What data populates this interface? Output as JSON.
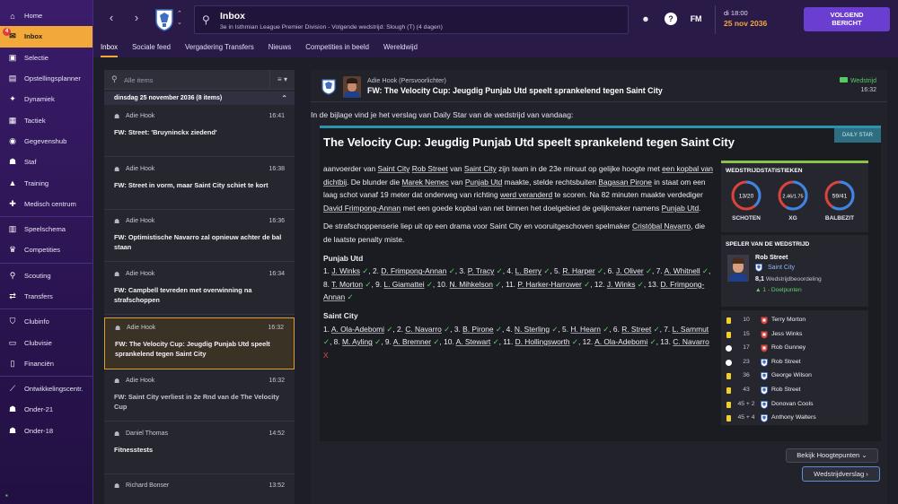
{
  "sidebar": {
    "items": [
      {
        "label": "Home",
        "icon": "home-icon"
      },
      {
        "label": "Inbox",
        "icon": "inbox-icon",
        "badge": "4",
        "active": true
      },
      {
        "label": "Selectie",
        "icon": "shirt-icon"
      },
      {
        "label": "Opstellingsplanner",
        "icon": "planner-icon"
      },
      {
        "label": "Dynamiek",
        "icon": "dynamics-icon"
      },
      {
        "label": "Tactiek",
        "icon": "tactics-icon"
      },
      {
        "label": "Gegevenshub",
        "icon": "data-hub-icon"
      },
      {
        "label": "Staf",
        "icon": "staff-icon"
      },
      {
        "label": "Training",
        "icon": "training-icon"
      },
      {
        "label": "Medisch centrum",
        "icon": "medical-icon"
      },
      {
        "label": "Speelschema",
        "icon": "schedule-icon"
      },
      {
        "label": "Competities",
        "icon": "trophy-icon"
      },
      {
        "label": "Scouting",
        "icon": "scouting-icon"
      },
      {
        "label": "Transfers",
        "icon": "transfers-icon"
      },
      {
        "label": "Clubinfo",
        "icon": "club-info-icon"
      },
      {
        "label": "Clubvisie",
        "icon": "club-vision-icon"
      },
      {
        "label": "Financiën",
        "icon": "finance-icon"
      },
      {
        "label": "Ontwikkelingscentr.",
        "icon": "development-icon"
      },
      {
        "label": "Onder-21",
        "icon": "u21-icon"
      },
      {
        "label": "Onder-18",
        "icon": "u18-icon"
      }
    ]
  },
  "topbar": {
    "title": "Inbox",
    "subtitle": "3e in Isthmian League Premier Division - Volgende wedstrijd: Slough (T) (4 dagen)",
    "fm_label": "FM",
    "time": "di 18:00",
    "date": "25 nov 2036",
    "next_line1": "VOLGEND",
    "next_line2": "BERICHT"
  },
  "subtabs": [
    "Inbox",
    "Sociale feed",
    "Vergadering Transfers",
    "Nieuws",
    "Competities in beeld",
    "Wereldwijd"
  ],
  "message_list": {
    "search_placeholder": "Alle items",
    "day_header": "dinsdag 25 november 2036 (8 items)",
    "messages": [
      {
        "sender": "Adie Hook",
        "time": "16:41",
        "subject": "FW: Street: 'Bruyninckx ziedend'"
      },
      {
        "sender": "Adie Hook",
        "time": "16:38",
        "subject": "FW: Street in vorm, maar Saint City schiet te kort"
      },
      {
        "sender": "Adie Hook",
        "time": "16:36",
        "subject": "FW: Optimistische Navarro zal opnieuw achter de bal staan"
      },
      {
        "sender": "Adie Hook",
        "time": "16:34",
        "subject": "FW: Campbell tevreden met overwinning na strafschoppen"
      },
      {
        "sender": "Adie Hook",
        "time": "16:32",
        "subject": "FW: The Velocity Cup: Jeugdig Punjab Utd speelt sprankelend tegen Saint City"
      },
      {
        "sender": "Adie Hook",
        "time": "16:32",
        "subject": "FW: Saint City verliest in 2e Rnd van de The Velocity Cup"
      },
      {
        "sender": "Daniel Thomas",
        "time": "14:52",
        "subject": "Fitnesstests"
      },
      {
        "sender": "Richard Bonser",
        "time": "13:52",
        "subject": ""
      }
    ]
  },
  "detail": {
    "from": "Adie Hook (Persvoorlichter)",
    "subject": "FW: The Velocity Cup: Jeugdig Punjab Utd speelt sprankelend tegen Saint City",
    "tag": "Wedstrijd",
    "time": "16:32",
    "intro": "In de bijlage vind je het verslag van Daily Star van de wedstrijd van vandaag:",
    "article": {
      "source": "DAILY STAR",
      "title": "The Velocity Cup: Jeugdig Punjab Utd speelt sprankelend tegen Saint City",
      "team1": "Punjab Utd",
      "team2": "Saint City"
    }
  },
  "match_stats": {
    "title": "WEDSTRIJDSTATISTIEKEN",
    "rings": [
      {
        "value": "13/20",
        "label": "SCHOTEN",
        "home_share": 0.39
      },
      {
        "value": "2.46/1.75",
        "label": "XG",
        "home_share": 0.58
      },
      {
        "value": "59/41",
        "label": "BALBEZIT",
        "home_share": 0.59
      }
    ]
  },
  "player_of_match": {
    "title": "SPELER VAN DE WEDSTRIJD",
    "name": "Rob Street",
    "club": "Saint City",
    "rating_value": "8,1",
    "rating_label": "Wedstrijdbeoordeling",
    "goals": "1 - Doelpunten"
  },
  "events": [
    {
      "type": "yellow-card",
      "minute": "10",
      "team": "punjab",
      "player": "Terry Morton"
    },
    {
      "type": "yellow-card",
      "minute": "15",
      "team": "punjab",
      "player": "Jess Winks"
    },
    {
      "type": "goal",
      "minute": "17",
      "team": "punjab",
      "player": "Rob Gunney"
    },
    {
      "type": "goal",
      "minute": "23",
      "team": "saint-city",
      "player": "Rob Street"
    },
    {
      "type": "yellow-card",
      "minute": "36",
      "team": "saint-city",
      "player": "George Wilson"
    },
    {
      "type": "yellow-card",
      "minute": "43",
      "team": "saint-city",
      "player": "Rob Street"
    },
    {
      "type": "yellow-card",
      "minute": "45 + 2",
      "team": "saint-city",
      "player": "Donovan Cools"
    },
    {
      "type": "yellow-card",
      "minute": "45 + 4",
      "team": "saint-city",
      "player": "Anthony Walters"
    }
  ],
  "buttons": {
    "highlights": "Bekijk Hoogtepunten",
    "report": "Wedstrijdverslag"
  },
  "colors": {
    "accent_orange": "#f3a93a",
    "sidebar_purple": "#3a1c6b",
    "button_purple": "#6a3ed0",
    "success_green": "#5fd36a",
    "error_red": "#e24b4b",
    "ring_home_blue": "#3a86e8",
    "ring_away_red": "#d9443c"
  }
}
